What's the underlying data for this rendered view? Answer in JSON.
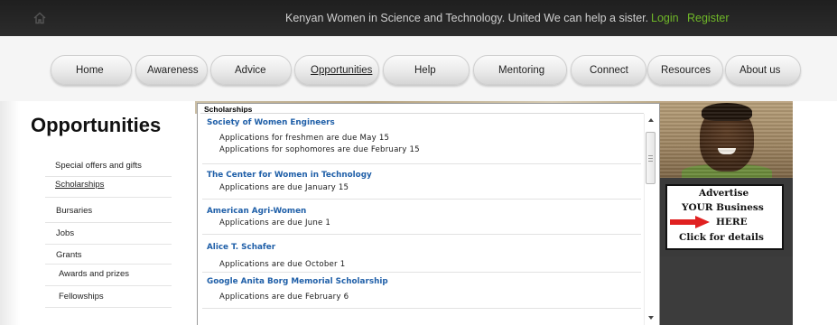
{
  "topbar": {
    "home_icon": "home-icon",
    "tagline": "Kenyan Women in Science and Technology. United We can help a sister.",
    "login": "Login",
    "register": "Register",
    "link_color": "#6fb728"
  },
  "nav": {
    "items": [
      "Home",
      "Awareness",
      "Advice",
      "Opportunities",
      "Help",
      "Mentoring",
      "Connect",
      "Resources",
      "About us"
    ],
    "active": "Opportunities"
  },
  "sidebar": {
    "title": "Opportunities",
    "items": [
      "Special offers and gifts",
      "Scholarships",
      "Bursaries",
      "Jobs",
      "Grants",
      "Awards and prizes",
      "Fellowships"
    ],
    "active": "Scholarships"
  },
  "scholarships": {
    "title": "Scholarships",
    "entries": [
      {
        "name": "Society of Women Engineers",
        "lines": [
          "Applications for freshmen are due May 15",
          "Applications for sophomores are due February 15"
        ]
      },
      {
        "name": "The Center for Women in Technology",
        "lines": [
          "Applications are due January 15"
        ]
      },
      {
        "name": "American Agri-Women",
        "lines": [
          "Applications are due June 1"
        ]
      },
      {
        "name": "Alice T. Schafer",
        "lines": [
          "Applications are due October 1"
        ]
      },
      {
        "name": "Google Anita Borg Memorial Scholarship",
        "lines": [
          "Applications are due February 6"
        ]
      }
    ],
    "link_color": "#1f5fa8"
  },
  "ad": {
    "line1": "Advertise",
    "line2": "YOUR Business",
    "line3": "HERE",
    "line4": "Click for details",
    "arrow_color": "#e02020"
  }
}
